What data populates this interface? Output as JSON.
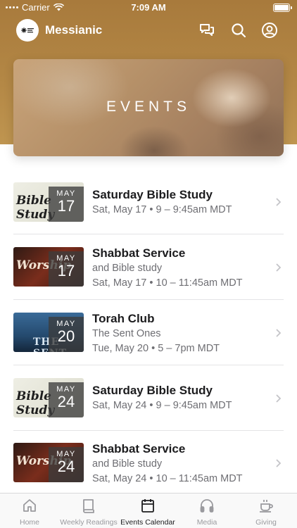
{
  "status_bar": {
    "carrier": "Carrier",
    "time": "7:09 AM"
  },
  "header": {
    "app_name": "Messianic"
  },
  "banner": {
    "title": "EVENTS"
  },
  "events": [
    {
      "thumb": "bible",
      "thumb_text": "Bible Study",
      "month": "MAY",
      "day": "17",
      "title": "Saturday Bible Study",
      "lines": [
        "Sat, May 17 • 9 – 9:45am MDT"
      ]
    },
    {
      "thumb": "worship",
      "thumb_text": "Worship",
      "month": "MAY",
      "day": "17",
      "title": "Shabbat Service",
      "lines": [
        "and Bible study",
        "Sat, May 17 • 10 – 11:45am MDT"
      ]
    },
    {
      "thumb": "torah",
      "thumb_text": "THE SENT ONES",
      "month": "MAY",
      "day": "20",
      "title": "Torah Club",
      "lines": [
        "The Sent Ones",
        "Tue, May 20 • 5 – 7pm MDT"
      ]
    },
    {
      "thumb": "bible",
      "thumb_text": "Bible Study",
      "month": "MAY",
      "day": "24",
      "title": "Saturday Bible Study",
      "lines": [
        "Sat, May 24 • 9 – 9:45am MDT"
      ]
    },
    {
      "thumb": "worship",
      "thumb_text": "Worship",
      "month": "MAY",
      "day": "24",
      "title": "Shabbat Service",
      "lines": [
        "and Bible study",
        "Sat, May 24 • 10 – 11:45am MDT"
      ]
    }
  ],
  "tabs": [
    {
      "label": "Home",
      "icon": "home-icon"
    },
    {
      "label": "Weekly Readings",
      "icon": "book-icon"
    },
    {
      "label": "Events Calendar",
      "icon": "calendar-icon",
      "active": true
    },
    {
      "label": "Media",
      "icon": "headphones-icon"
    },
    {
      "label": "Giving",
      "icon": "coffee-cup-icon"
    }
  ],
  "colors": {
    "header_gold": "#b38745",
    "active_tab": "#1c1c1e",
    "inactive_tab": "#9a9a9e"
  }
}
